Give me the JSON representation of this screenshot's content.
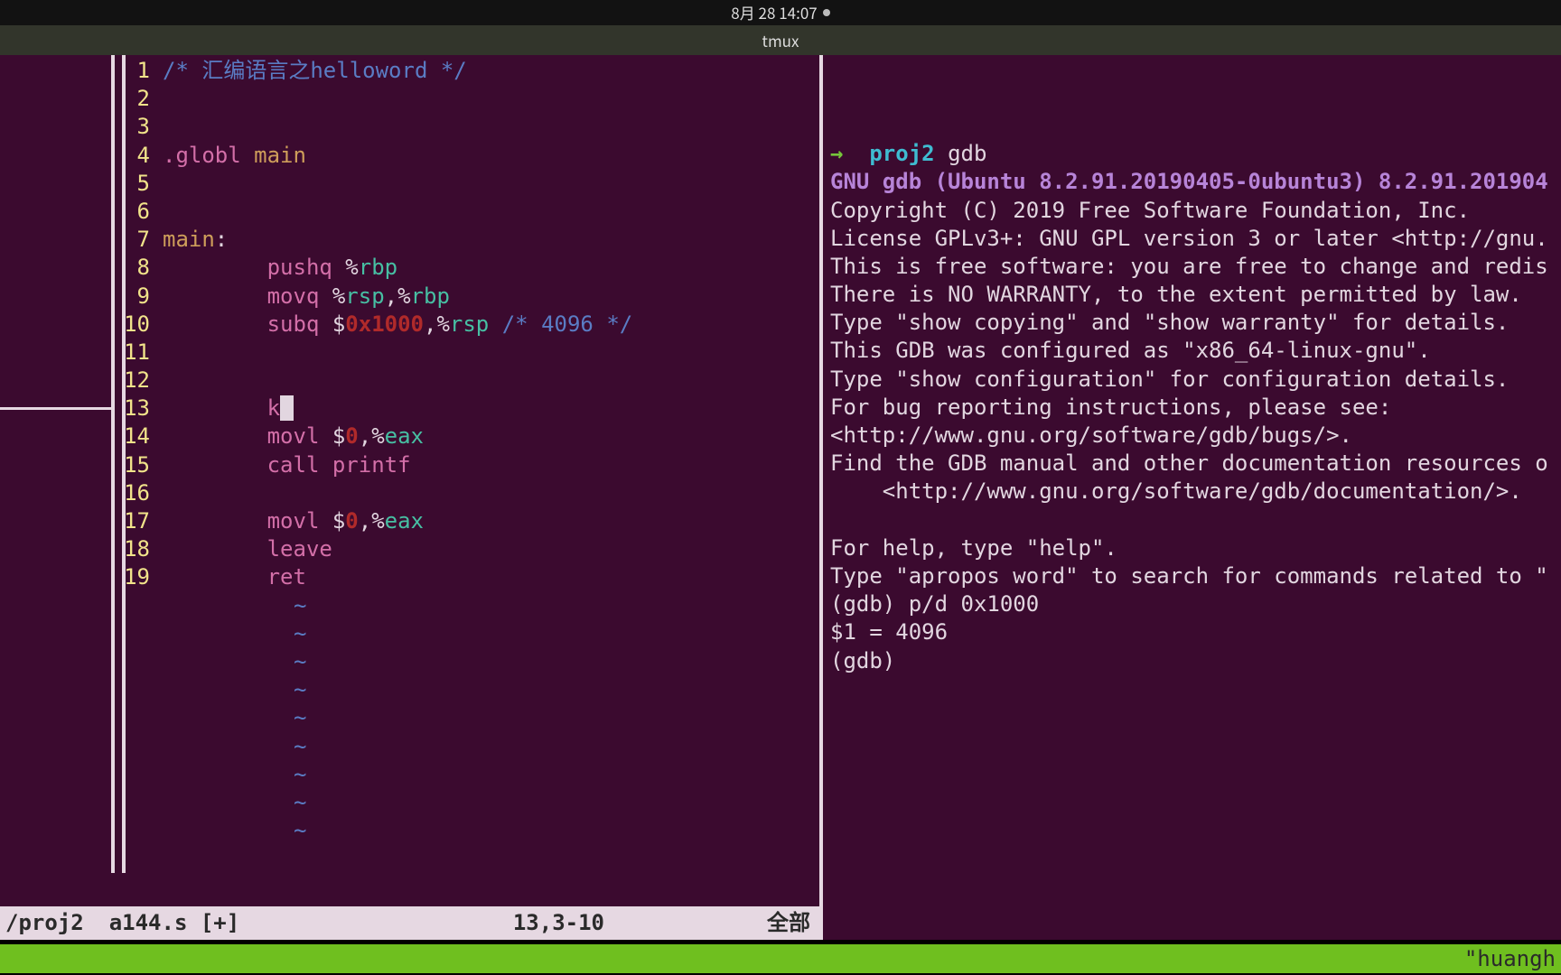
{
  "topbar": {
    "datetime": "8月 28  14:07"
  },
  "tab": {
    "title": "tmux"
  },
  "editor": {
    "lines": [
      {
        "n": "1",
        "segs": [
          {
            "c": "c-comment",
            "v": "/* 汇编语言之helloword */"
          }
        ]
      },
      {
        "n": "2",
        "segs": []
      },
      {
        "n": "3",
        "segs": []
      },
      {
        "n": "4",
        "segs": [
          {
            "c": "c-kw",
            "v": ".globl "
          },
          {
            "c": "c-dir",
            "v": "main"
          }
        ]
      },
      {
        "n": "5",
        "segs": []
      },
      {
        "n": "6",
        "segs": []
      },
      {
        "n": "7",
        "segs": [
          {
            "c": "c-dir",
            "v": "main"
          },
          {
            "c": "c-op",
            "v": ":"
          }
        ]
      },
      {
        "n": "8",
        "segs": [
          {
            "c": "c-op",
            "v": "        "
          },
          {
            "c": "c-kw",
            "v": "pushq "
          },
          {
            "c": "c-op",
            "v": "%"
          },
          {
            "c": "c-reg",
            "v": "rbp"
          }
        ]
      },
      {
        "n": "9",
        "segs": [
          {
            "c": "c-op",
            "v": "        "
          },
          {
            "c": "c-kw",
            "v": "movq "
          },
          {
            "c": "c-op",
            "v": "%"
          },
          {
            "c": "c-reg",
            "v": "rsp"
          },
          {
            "c": "c-op",
            "v": ",%"
          },
          {
            "c": "c-reg",
            "v": "rbp"
          }
        ]
      },
      {
        "n": "10",
        "segs": [
          {
            "c": "c-op",
            "v": "        "
          },
          {
            "c": "c-kw",
            "v": "subq "
          },
          {
            "c": "c-op",
            "v": "$"
          },
          {
            "c": "c-num",
            "v": "0x1000"
          },
          {
            "c": "c-op",
            "v": ",%"
          },
          {
            "c": "c-reg",
            "v": "rsp"
          },
          {
            "c": "c-op",
            "v": " "
          },
          {
            "c": "c-comment",
            "v": "/* 4096 */"
          }
        ]
      },
      {
        "n": "11",
        "segs": []
      },
      {
        "n": "12",
        "segs": []
      },
      {
        "n": "13",
        "segs": [
          {
            "c": "c-op",
            "v": "        "
          },
          {
            "c": "c-kw",
            "v": "k"
          },
          {
            "cursor": true
          }
        ]
      },
      {
        "n": "14",
        "segs": [
          {
            "c": "c-op",
            "v": "        "
          },
          {
            "c": "c-kw",
            "v": "movl "
          },
          {
            "c": "c-op",
            "v": "$"
          },
          {
            "c": "c-num",
            "v": "0"
          },
          {
            "c": "c-op",
            "v": ",%"
          },
          {
            "c": "c-reg",
            "v": "eax"
          }
        ]
      },
      {
        "n": "15",
        "segs": [
          {
            "c": "c-op",
            "v": "        "
          },
          {
            "c": "c-kw",
            "v": "call "
          },
          {
            "c": "c-kw",
            "v": "printf"
          }
        ]
      },
      {
        "n": "16",
        "segs": []
      },
      {
        "n": "17",
        "segs": [
          {
            "c": "c-op",
            "v": "        "
          },
          {
            "c": "c-kw",
            "v": "movl "
          },
          {
            "c": "c-op",
            "v": "$"
          },
          {
            "c": "c-num",
            "v": "0"
          },
          {
            "c": "c-op",
            "v": ",%"
          },
          {
            "c": "c-reg",
            "v": "eax"
          }
        ]
      },
      {
        "n": "18",
        "segs": [
          {
            "c": "c-op",
            "v": "        "
          },
          {
            "c": "c-kw",
            "v": "leave"
          }
        ]
      },
      {
        "n": "19",
        "segs": [
          {
            "c": "c-op",
            "v": "        "
          },
          {
            "c": "c-kw",
            "v": "ret"
          }
        ]
      }
    ],
    "tilde_count": 9,
    "status": {
      "path": "/proj2",
      "file": "a144.s [+]",
      "position": "13,3-10",
      "percent": "全部"
    }
  },
  "terminal": {
    "lines": [
      [
        {
          "c": "p-green",
          "v": "→  "
        },
        {
          "c": "p-cyan",
          "v": "proj2 "
        },
        {
          "c": "p-white",
          "v": "gdb"
        }
      ],
      [
        {
          "c": "p-purple",
          "v": "GNU gdb (Ubuntu 8.2.91.20190405-0ubuntu3) 8.2.91.201904"
        }
      ],
      [
        {
          "c": "p-white",
          "v": "Copyright (C) 2019 Free Software Foundation, Inc."
        }
      ],
      [
        {
          "c": "p-white",
          "v": "License GPLv3+: GNU GPL version 3 or later <http://gnu."
        }
      ],
      [
        {
          "c": "p-white",
          "v": "This is free software: you are free to change and redis"
        }
      ],
      [
        {
          "c": "p-white",
          "v": "There is NO WARRANTY, to the extent permitted by law."
        }
      ],
      [
        {
          "c": "p-white",
          "v": "Type \"show copying\" and \"show warranty\" for details."
        }
      ],
      [
        {
          "c": "p-white",
          "v": "This GDB was configured as \"x86_64-linux-gnu\"."
        }
      ],
      [
        {
          "c": "p-white",
          "v": "Type \"show configuration\" for configuration details."
        }
      ],
      [
        {
          "c": "p-white",
          "v": "For bug reporting instructions, please see:"
        }
      ],
      [
        {
          "c": "p-white",
          "v": "<http://www.gnu.org/software/gdb/bugs/>."
        }
      ],
      [
        {
          "c": "p-white",
          "v": "Find the GDB manual and other documentation resources o"
        }
      ],
      [
        {
          "c": "p-white",
          "v": "    <http://www.gnu.org/software/gdb/documentation/>."
        }
      ],
      [
        {
          "c": "p-white",
          "v": ""
        }
      ],
      [
        {
          "c": "p-white",
          "v": "For help, type \"help\"."
        }
      ],
      [
        {
          "c": "p-white",
          "v": "Type \"apropos word\" to search for commands related to \""
        }
      ],
      [
        {
          "c": "p-white",
          "v": "(gdb) p/d 0x1000"
        }
      ],
      [
        {
          "c": "p-white",
          "v": "$1 = 4096"
        }
      ],
      [
        {
          "c": "p-white",
          "v": "(gdb) "
        }
      ]
    ]
  },
  "tmux": {
    "right": "\"huangh"
  }
}
